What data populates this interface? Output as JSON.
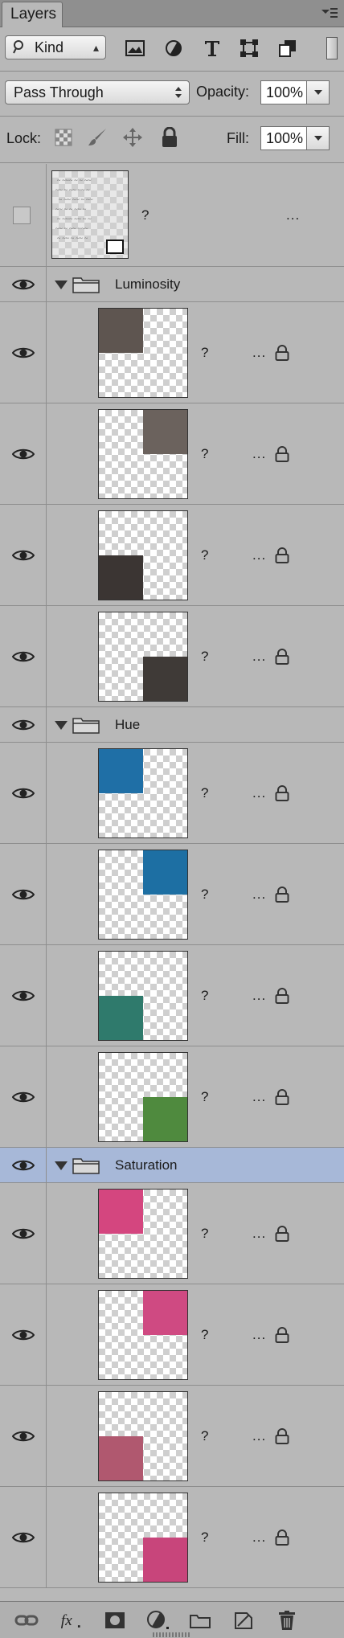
{
  "panel": {
    "tab_title": "Layers",
    "menu_icon": "panel-menu-icon"
  },
  "filter": {
    "kind_label": "Kind",
    "icons": [
      "search-icon",
      "image-filter-icon",
      "adjustment-filter-icon",
      "type-filter-icon",
      "shape-filter-icon",
      "smart-object-filter-icon",
      "filter-toggle-icon"
    ]
  },
  "blend": {
    "mode": "Pass Through",
    "opacity_label": "Opacity:",
    "opacity_value": "100%"
  },
  "lock": {
    "label": "Lock:",
    "fill_label": "Fill:",
    "fill_value": "100%"
  },
  "layers": [
    {
      "type": "layer",
      "name": "?",
      "dots": "...",
      "visible": false,
      "locked": false,
      "thumb": "text"
    },
    {
      "type": "group",
      "name": "Luminosity",
      "visible": true
    },
    {
      "type": "layer",
      "name": "?",
      "dots": "...",
      "visible": true,
      "locked": true,
      "quad": "tl",
      "fill": "#5e5550"
    },
    {
      "type": "layer",
      "name": "?",
      "dots": "...",
      "visible": true,
      "locked": true,
      "quad": "tr",
      "fill": "#6b625d"
    },
    {
      "type": "layer",
      "name": "?",
      "dots": "...",
      "visible": true,
      "locked": true,
      "quad": "bl",
      "fill": "#3b3533"
    },
    {
      "type": "layer",
      "name": "?",
      "dots": "...",
      "visible": true,
      "locked": true,
      "quad": "br",
      "fill": "#3f3a37"
    },
    {
      "type": "group",
      "name": "Hue",
      "visible": true
    },
    {
      "type": "layer",
      "name": "?",
      "dots": "...",
      "visible": true,
      "locked": true,
      "quad": "tl",
      "fill": "#1f6fa6"
    },
    {
      "type": "layer",
      "name": "?",
      "dots": "...",
      "visible": true,
      "locked": true,
      "quad": "tr",
      "fill": "#1d6fa3"
    },
    {
      "type": "layer",
      "name": "?",
      "dots": "...",
      "visible": true,
      "locked": true,
      "quad": "bl",
      "fill": "#2f7a6c"
    },
    {
      "type": "layer",
      "name": "?",
      "dots": "...",
      "visible": true,
      "locked": true,
      "quad": "br",
      "fill": "#4f8a3e"
    },
    {
      "type": "group",
      "name": "Saturation",
      "visible": true,
      "selected": true
    },
    {
      "type": "layer",
      "name": "?",
      "dots": "...",
      "visible": true,
      "locked": true,
      "quad": "tl",
      "fill": "#d4467f"
    },
    {
      "type": "layer",
      "name": "?",
      "dots": "...",
      "visible": true,
      "locked": true,
      "quad": "tr",
      "fill": "#cf4a82"
    },
    {
      "type": "layer",
      "name": "?",
      "dots": "...",
      "visible": true,
      "locked": true,
      "quad": "bl",
      "fill": "#b0586f"
    },
    {
      "type": "layer",
      "name": "?",
      "dots": "...",
      "visible": true,
      "locked": true,
      "quad": "br",
      "fill": "#c8457b"
    }
  ],
  "bottom_bar": {
    "icons": [
      "link-layers-icon",
      "fx-icon",
      "layer-mask-icon",
      "adjustment-layer-icon",
      "new-group-icon",
      "new-layer-icon",
      "delete-layer-icon"
    ]
  },
  "colors": {
    "panel_bg": "#b8b8b8",
    "selected_row": "#a7b8d8"
  }
}
